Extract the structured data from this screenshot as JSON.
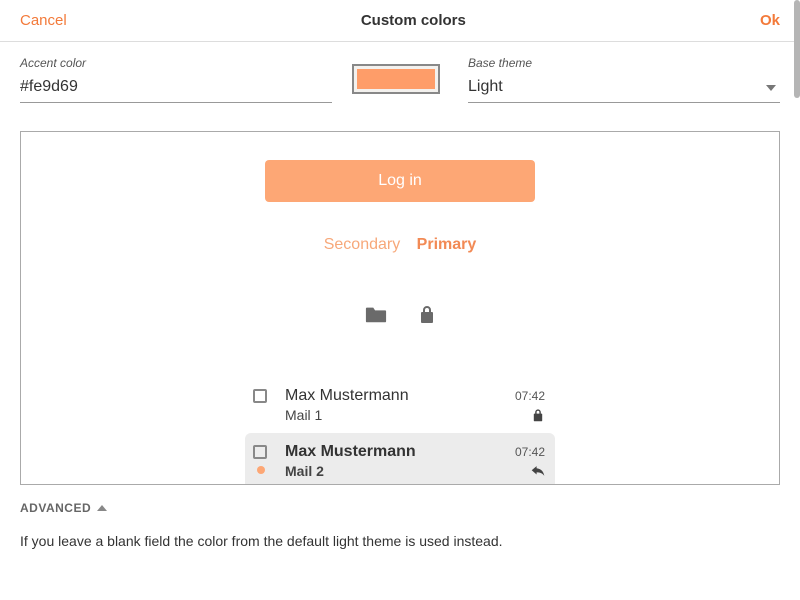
{
  "header": {
    "cancel_label": "Cancel",
    "title": "Custom colors",
    "ok_label": "Ok"
  },
  "accent": {
    "label": "Accent color",
    "value": "#fe9d69",
    "swatch_color": "#fe9d69"
  },
  "base_theme": {
    "label": "Base theme",
    "value": "Light"
  },
  "preview": {
    "login_label": "Log in",
    "tab_secondary": "Secondary",
    "tab_primary": "Primary"
  },
  "mail": {
    "items": [
      {
        "name": "Max Mustermann",
        "subject": "Mail 1",
        "time": "07:42",
        "selected": false,
        "right_icon": "lock",
        "unread": false
      },
      {
        "name": "Max Mustermann",
        "subject": "Mail 2",
        "time": "07:42",
        "selected": true,
        "right_icon": "reply",
        "unread": true
      }
    ]
  },
  "advanced": {
    "label": "ADVANCED",
    "description": "If you leave a blank field the color from the default light theme is used instead."
  },
  "icons": {
    "folder": "folder-icon",
    "lock": "lock-icon",
    "reply": "reply-icon",
    "chevron_down": "chevron-down-icon",
    "chevron_up": "chevron-up-icon",
    "checkbox": "checkbox-icon"
  }
}
